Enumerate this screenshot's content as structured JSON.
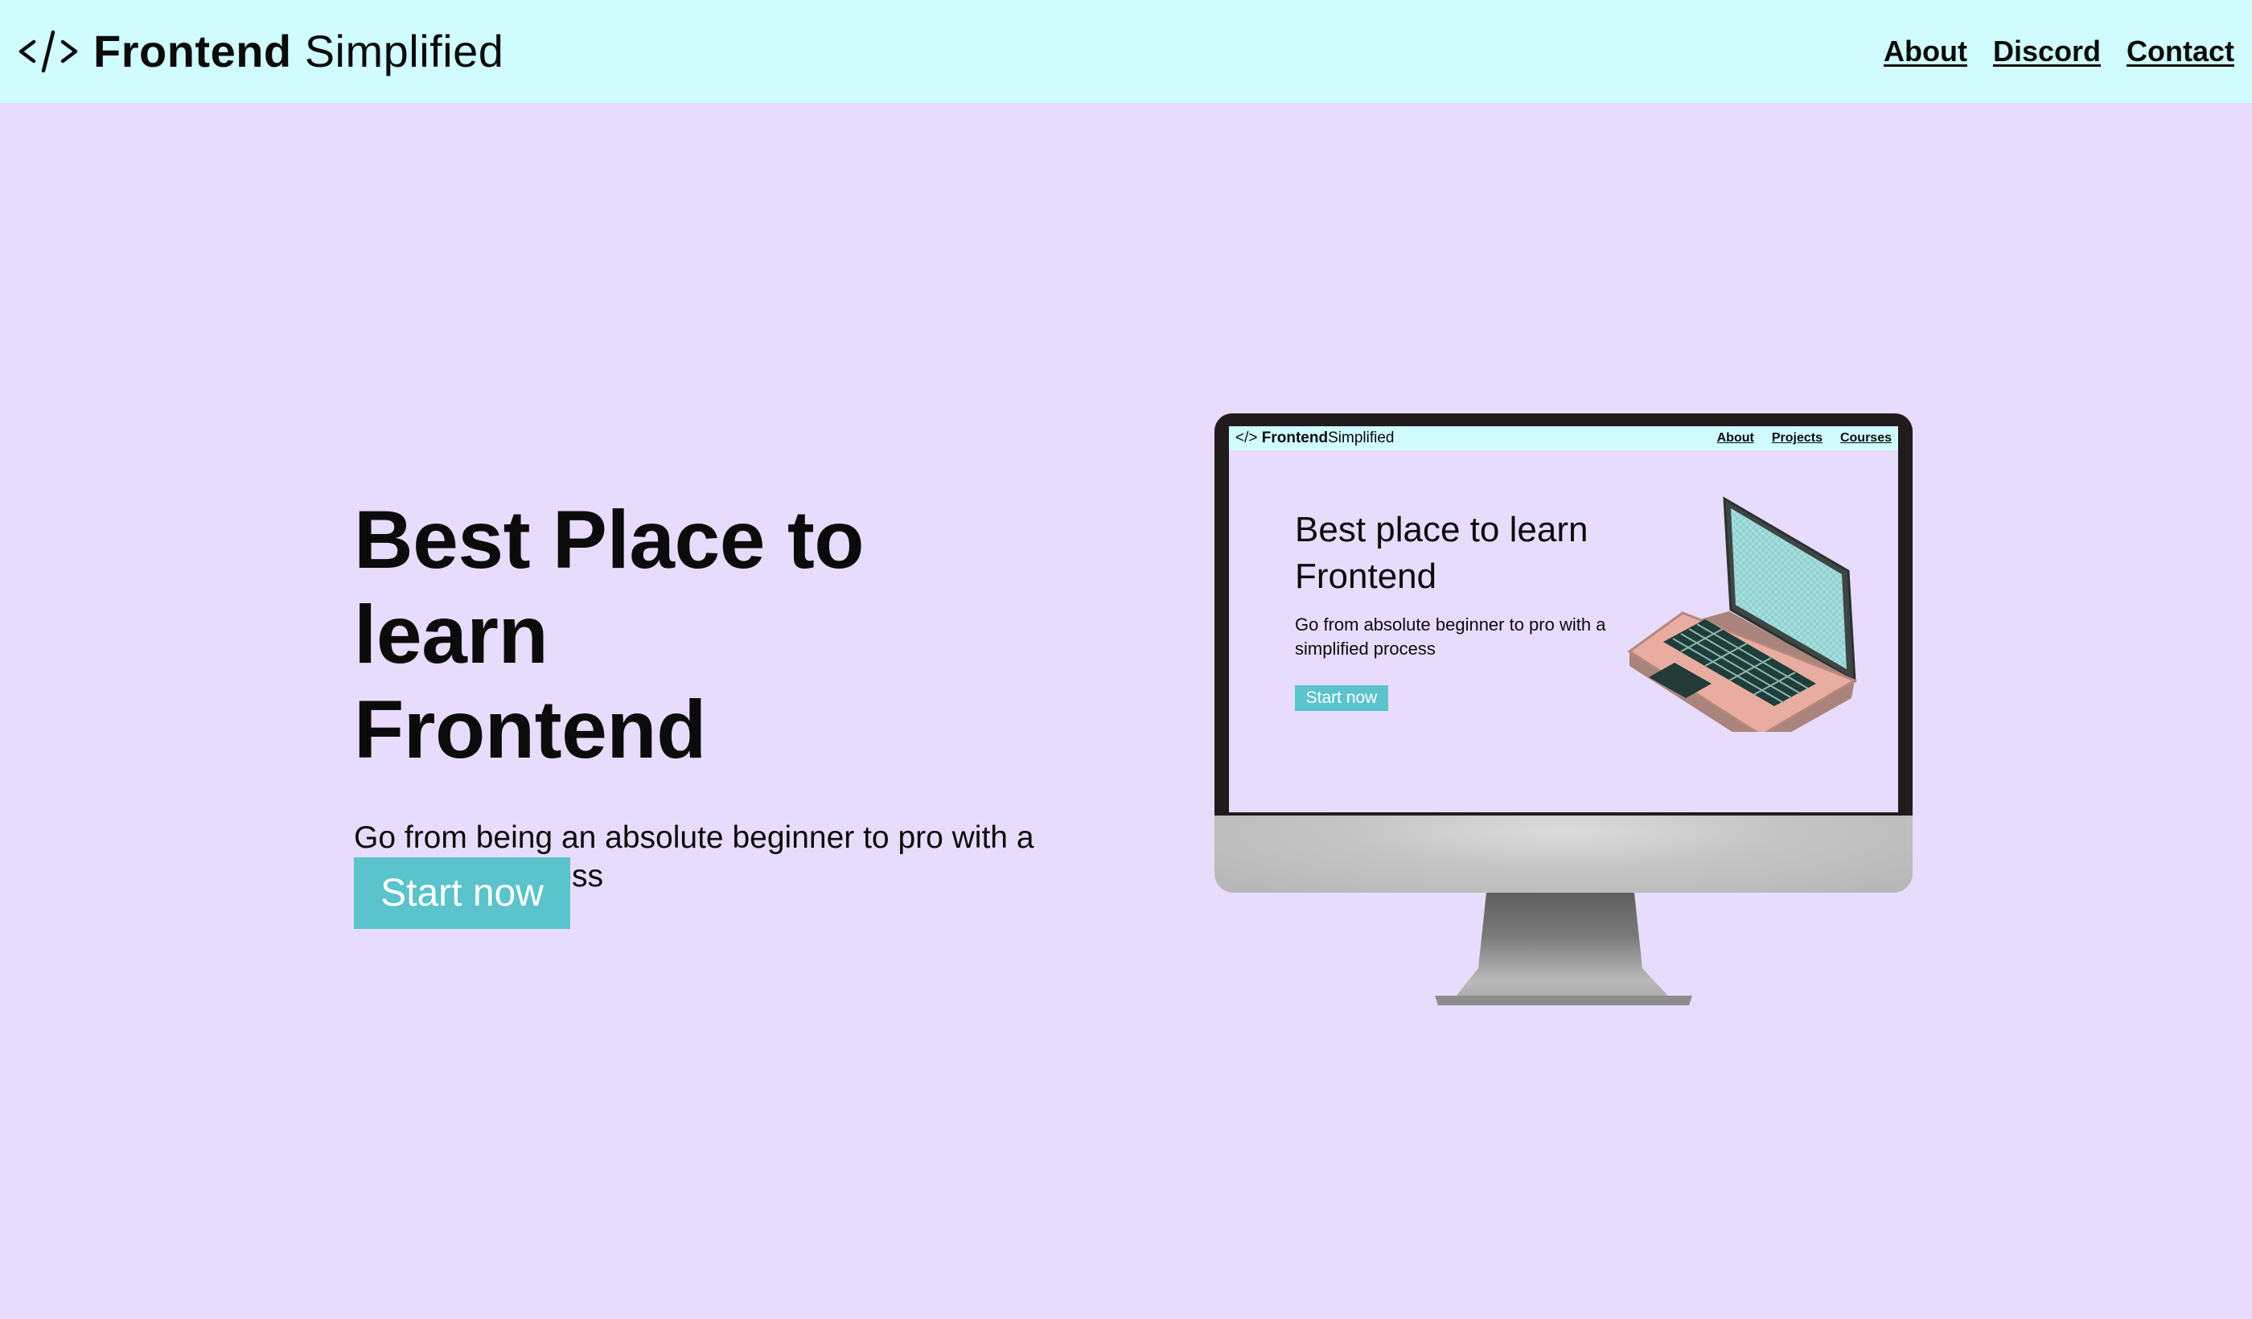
{
  "brand": {
    "bold": "Frontend",
    "light": "Simplified",
    "icon": "code-brackets-icon"
  },
  "nav": {
    "links": [
      "About",
      "Discord",
      "Contact"
    ]
  },
  "hero": {
    "title_line1": "Best Place to learn",
    "title_line2": "Frontend",
    "subtitle": "Go from being an absolute beginner to pro with a simplified process",
    "cta": "Start now"
  },
  "monitor_screen": {
    "brand_bold": "Frontend",
    "brand_light": "Simplified",
    "nav_links": [
      "About",
      "Projects",
      "Courses"
    ],
    "title_line1": "Best place to learn",
    "title_line2": "Frontend",
    "subtitle": "Go from absolute beginner to pro with a simplified process",
    "cta": "Start now"
  },
  "colors": {
    "page_background": "#e8dcfc",
    "nav_background": "#d0fcfd",
    "accent_button": "#5ac3cb",
    "text": "#0b0b0b"
  }
}
